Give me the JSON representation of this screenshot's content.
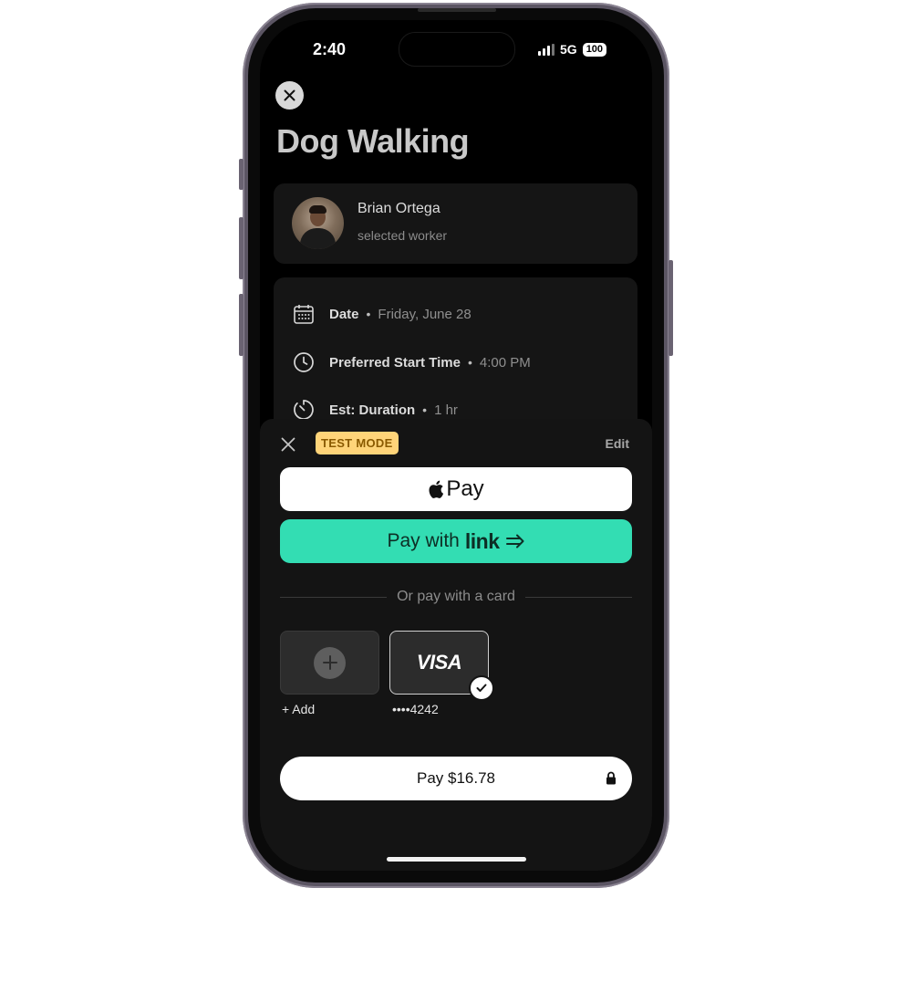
{
  "status_bar": {
    "time": "2:40",
    "network": "5G",
    "battery": "100"
  },
  "header": {
    "title": "Dog Walking"
  },
  "worker": {
    "name": "Brian Ortega",
    "subtitle": "selected worker"
  },
  "details": [
    {
      "icon": "calendar-icon",
      "label": "Date",
      "value": "Friday, June 28"
    },
    {
      "icon": "clock-icon",
      "label": "Preferred Start Time",
      "value": "4:00 PM"
    },
    {
      "icon": "timer-icon",
      "label": "Est: Duration",
      "value": "1 hr"
    }
  ],
  "detail_separator": "•",
  "payment_sheet": {
    "badge": "TEST MODE",
    "edit_label": "Edit",
    "apple_pay_label": "Pay",
    "link_prefix": "Pay with",
    "link_brand": "link",
    "divider_text": "Or pay with a card",
    "add_label": "+ Add",
    "card_brand": "VISA",
    "card_last4": "••••4242",
    "pay_label": "Pay $16.78"
  },
  "colors": {
    "background": "#000000",
    "card": "#151515",
    "link_green": "#33ddb3",
    "test_badge": "#ffd479"
  }
}
